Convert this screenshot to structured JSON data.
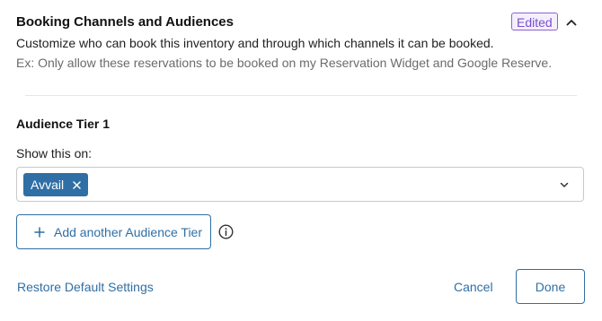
{
  "section": {
    "title": "Booking Channels and Audiences",
    "description": "Customize who can book this inventory and through which channels it can be booked.",
    "example": "Ex: Only allow these reservations to be booked on my Reservation Widget and Google Reserve.",
    "badge": "Edited",
    "collapse_icon": "chevron-up-icon"
  },
  "audience_tier": {
    "title": "Audience Tier 1",
    "show_label": "Show this on:",
    "selected_chips": [
      {
        "label": "Avvail",
        "remove_icon": "close-icon"
      }
    ],
    "dropdown_icon": "chevron-down-icon"
  },
  "actions": {
    "add_tier_label": "Add another Audience Tier",
    "add_icon": "plus-icon",
    "info_icon": "info-icon",
    "restore_label": "Restore Default Settings",
    "cancel_label": "Cancel",
    "done_label": "Done"
  },
  "colors": {
    "accent": "#2f6fa5",
    "badge": "#7a4fcf",
    "chip_bg": "#2f6fa5"
  }
}
